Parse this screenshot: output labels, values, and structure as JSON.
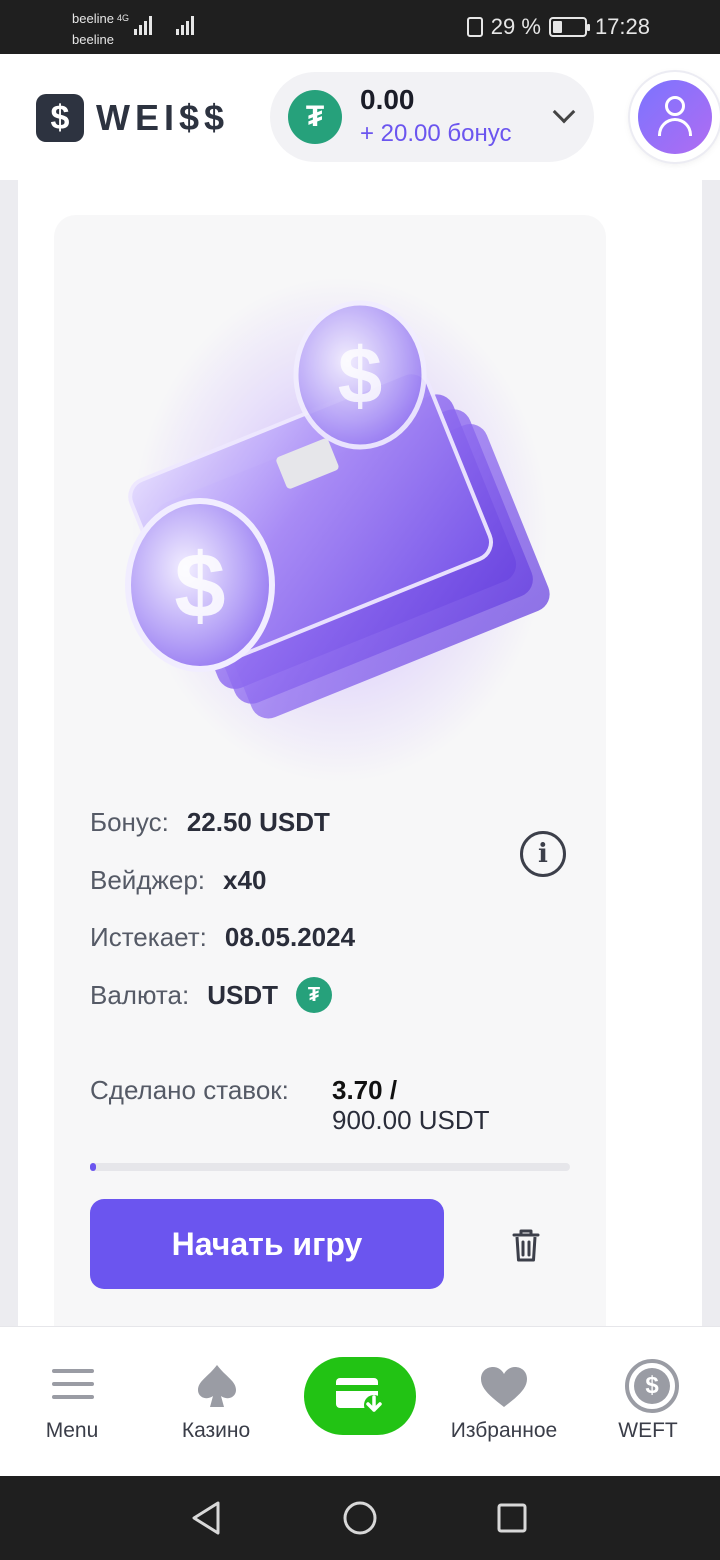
{
  "status_bar": {
    "carrier1": "beeline",
    "carrier1_net": "4G",
    "carrier2": "beeline",
    "battery": "29 %",
    "time": "17:28"
  },
  "header": {
    "logo_text": "WEI$$",
    "logo_mark": "$",
    "balance": "0.00",
    "bonus": "+ 20.00 бонус",
    "coin_icon": "tether-icon",
    "coin_glyph": "₮"
  },
  "bonus_card": {
    "rows": [
      {
        "label": "Бонус:",
        "value": "22.50 USDT"
      },
      {
        "label": "Вейджер:",
        "value": "x40"
      },
      {
        "label": "Истекает:",
        "value": "08.05.2024"
      },
      {
        "label": "Валюта:",
        "value": "USDT"
      }
    ],
    "info_glyph": "i",
    "wager_label": "Сделано ставок:",
    "wager_done": "3.70 /",
    "wager_total": "900.00 USDT",
    "progress_fraction": 0.0041,
    "play_button": "Начать игру"
  },
  "bottom_nav": {
    "items": [
      {
        "label": "Menu",
        "icon": "menu-icon"
      },
      {
        "label": "Казино",
        "icon": "spade-icon"
      },
      {
        "label": "",
        "icon": "deposit-icon"
      },
      {
        "label": "Избранное",
        "icon": "heart-icon"
      },
      {
        "label": "WEFT",
        "icon": "weft-coin-icon"
      }
    ]
  },
  "colors": {
    "accent": "#6b55ef",
    "tether": "#26a17b",
    "deposit": "#22c314"
  }
}
